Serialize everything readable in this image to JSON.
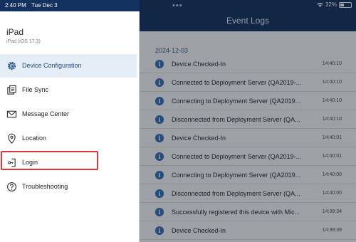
{
  "status_bar": {
    "time": "2:40 PM",
    "date": "Tue Dec 3",
    "battery": "32%"
  },
  "device": {
    "name": "iPad",
    "subtitle": "iPad (iOS 17.3)"
  },
  "menu": [
    {
      "label": "Device Configuration",
      "icon": "gear-icon",
      "active": true
    },
    {
      "label": "File Sync",
      "icon": "file-sync-icon",
      "active": false
    },
    {
      "label": "Message Center",
      "icon": "mail-icon",
      "active": false
    },
    {
      "label": "Location",
      "icon": "location-pin-icon",
      "active": false
    },
    {
      "label": "Login",
      "icon": "login-icon",
      "active": false
    },
    {
      "label": "Troubleshooting",
      "icon": "help-circle-icon",
      "active": false
    }
  ],
  "event_logs": {
    "title": "Event Logs",
    "date": "2024-12-03",
    "entries": [
      {
        "message": "Device Checked-In",
        "time": "14:40:10"
      },
      {
        "message": "Connected to Deployment Server (QA2019-...",
        "time": "14:40:10"
      },
      {
        "message": "Connecting to Deployment Server (QA2019...",
        "time": "14:40:10"
      },
      {
        "message": "Disconnected from Deployment Server (QA...",
        "time": "14:40:10"
      },
      {
        "message": "Device Checked-In",
        "time": "14:40:01"
      },
      {
        "message": "Connected to Deployment Server (QA2019-...",
        "time": "14:40:01"
      },
      {
        "message": "Connecting to Deployment Server (QA2019...",
        "time": "14:40:00"
      },
      {
        "message": "Disconnected from Deployment Server (QA...",
        "time": "14:40:00"
      },
      {
        "message": "Successfully registered this device with Mic...",
        "time": "14:39:34"
      },
      {
        "message": "Device Checked-In",
        "time": "14:39:39"
      }
    ]
  },
  "colors": {
    "header": "#14325f",
    "accent": "#1e4f8c",
    "active_bg": "#e4ecf6",
    "highlight": "#e2343a",
    "info": "#2e6eb6"
  }
}
